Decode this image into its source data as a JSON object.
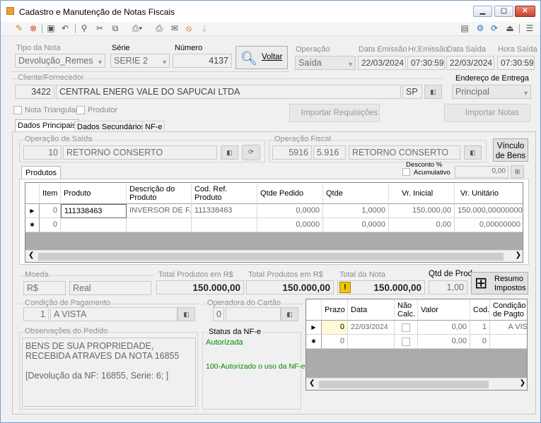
{
  "window": {
    "title": "Cadastro e Manutenção de Notas Fiscais"
  },
  "header": {
    "tipo_label": "Tipo da Nota",
    "tipo_value": "Devolução_Remes",
    "serie_label": "Série",
    "serie_value": "SERIE 2",
    "numero_label": "Número",
    "numero_value": "4137",
    "voltar_label": "Voltar",
    "operacao_label": "Operação",
    "operacao_value": "Saída",
    "data_emissao_label": "Data Emissão",
    "data_emissao_value": "22/03/2024",
    "hr_emissao_label": "Hr.Emissão",
    "hr_emissao_value": "07:30:59",
    "data_saida_label": "Data Saída",
    "data_saida_value": "22/03/2024",
    "hora_saida_label": "Hora Saída",
    "hora_saida_value": "07:30:59",
    "cliente_label": "Cliente/Fornecedor",
    "cliente_code": "3422",
    "cliente_name": "CENTRAL ENERG VALE DO SAPUCAI LTDA",
    "cliente_uf": "SP",
    "endereco_label": "Endereço de Entrega",
    "endereco_value": "Principal",
    "nota_triangular": "Nota Triangular",
    "produtor": "Produtor",
    "importar_req": "Importar Requisições",
    "importar_notas": "Importar Notas"
  },
  "tabs": [
    "Dados Principais",
    "Dados Secundários",
    "NF-e"
  ],
  "opsaida": {
    "label": "Operação de Saída",
    "code": "10",
    "name": "RETORNO CONSERTO"
  },
  "opfiscal": {
    "label": "Operação Fiscal",
    "code": "5916",
    "cfop": "5.916",
    "name": "RETORNO CONSERTO"
  },
  "vinculo_label": "Vínculo de Bens",
  "produtos": {
    "tab": "Produtos",
    "desconto_label": "Desconto %",
    "acumulativo": "Acumulativo",
    "desconto_value": "0,00",
    "columns": [
      "Item",
      "Produto",
      "Descrição do Produto",
      "Cod. Ref. Produto",
      "Qtde Pedido",
      "Qtde",
      "Vr. Inicial",
      "Vr. Unitário"
    ],
    "rows": [
      [
        "0",
        "111338463",
        "INVERSOR DE F...",
        "111338463",
        "0,0000",
        "1,0000",
        "150.000,00",
        "150.000,00000000"
      ],
      [
        "0",
        "",
        "",
        "",
        "0,0000",
        "0,0000",
        "0,00",
        "0,00000000"
      ]
    ]
  },
  "totals": {
    "moeda_label": "Moeda",
    "moeda_code": "R$",
    "moeda_name": "Real",
    "tp1_label": "Total Produtos em R$",
    "tp1_value": "150.000,00",
    "tp2_label": "Total Produtos em R$",
    "tp2_value": "150.000,00",
    "nota_label": "Total da Nota",
    "nota_value": "150.000,00",
    "qtd_label": "Qtd de Prod.",
    "qtd_value": "1,00",
    "resumo_label": "Resumo Impostos"
  },
  "pagamento": {
    "label": "Condição de Pagamento",
    "code": "1",
    "name": "A VISTA"
  },
  "cartao": {
    "label": "Operadora do Cartão",
    "code": "0"
  },
  "obs": {
    "label": "Observações do Pedido",
    "text": "BENS DE SUA PROPRIEDADE, RECEBIDA ATRAVES DA NOTA 16855\n\n[Devolução da NF: 16855, Serie: 6; ]"
  },
  "status": {
    "label": "Status da NF-e",
    "value": "Autorizada",
    "msg": "100-Autorizado o uso da NF-e"
  },
  "parcelas": {
    "columns": [
      "Prazo",
      "Data",
      "Não Calc.",
      "Valor",
      "Cod.",
      "Condição de Pagto"
    ],
    "rows": [
      [
        "0",
        "22/03/2024",
        "",
        "0,00",
        "1",
        "A VIS"
      ],
      [
        "0",
        "",
        "",
        "0,00",
        "0",
        ""
      ]
    ]
  }
}
